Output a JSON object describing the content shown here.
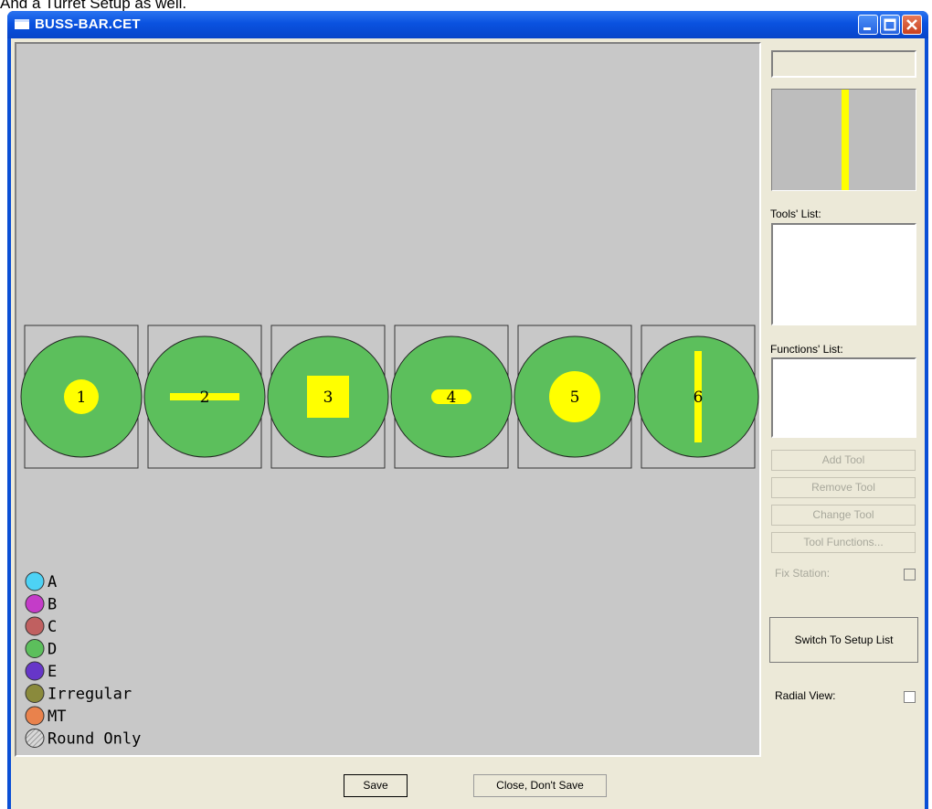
{
  "caption": "And a Turret Setup as well.",
  "window": {
    "title": "BUSS-BAR.CET"
  },
  "turret": {
    "stations": [
      {
        "label": "1",
        "tool_shape": "round",
        "tool_color": "#ffff00",
        "station_color": "#5cbf5c"
      },
      {
        "label": "2",
        "tool_shape": "horizontal-slot",
        "tool_color": "#ffff00",
        "station_color": "#5cbf5c"
      },
      {
        "label": "3",
        "tool_shape": "square",
        "tool_color": "#ffff00",
        "station_color": "#5cbf5c"
      },
      {
        "label": "4",
        "tool_shape": "obround",
        "tool_color": "#ffff00",
        "station_color": "#5cbf5c"
      },
      {
        "label": "5",
        "tool_shape": "large-round",
        "tool_color": "#ffff00",
        "station_color": "#5cbf5c"
      },
      {
        "label": "6",
        "tool_shape": "vertical-slot",
        "tool_color": "#ffff00",
        "station_color": "#5cbf5c"
      }
    ]
  },
  "legend": [
    {
      "label": "A",
      "color": "#4dd2f5"
    },
    {
      "label": "B",
      "color": "#c43cc8"
    },
    {
      "label": "C",
      "color": "#c06060"
    },
    {
      "label": "D",
      "color": "#5cbf5c"
    },
    {
      "label": "E",
      "color": "#6636c8"
    },
    {
      "label": "Irregular",
      "color": "#8a8a3c"
    },
    {
      "label": "MT",
      "color": "#e9824c"
    },
    {
      "label": "Round Only",
      "color": "hatched"
    }
  ],
  "sidebar": {
    "tools_list_label": "Tools' List:",
    "functions_list_label": "Functions' List:",
    "add_tool": "Add Tool",
    "remove_tool": "Remove Tool",
    "change_tool": "Change Tool",
    "tool_functions": "Tool Functions...",
    "fix_station": "Fix Station:",
    "switch_to_setup_list": "Switch To Setup List",
    "radial_view": "Radial View:"
  },
  "footer": {
    "save": "Save",
    "close_dont_save": "Close, Don't Save"
  },
  "colors": {
    "accent_yellow": "#ffff00",
    "canvas_gray": "#c8c8c8",
    "titlebar_blue": "#0a52e0"
  }
}
